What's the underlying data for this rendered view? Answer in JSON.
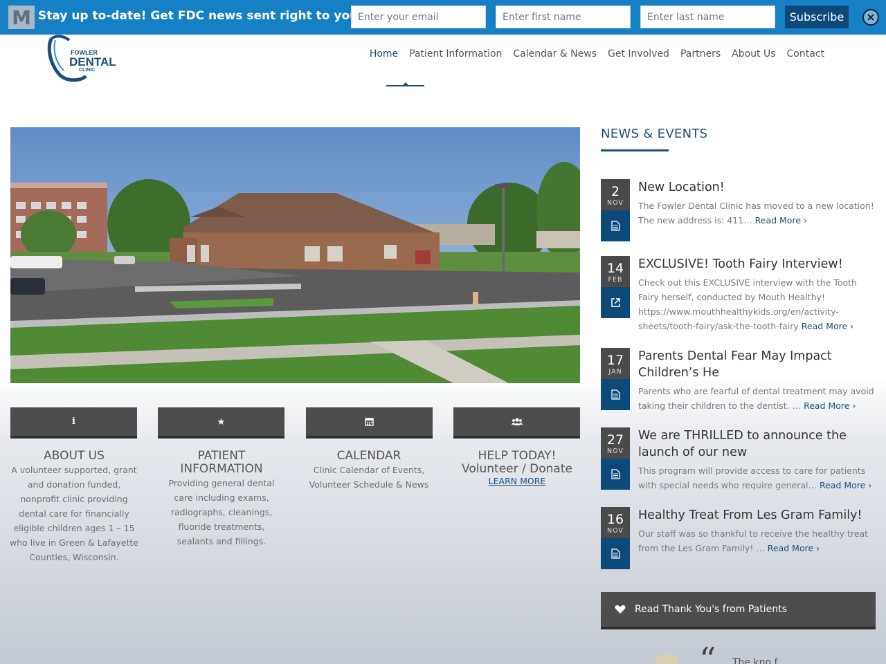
{
  "topbar": {
    "logo_letter": "M",
    "message": "Stay up to-date! Get FDC news sent right to your inbox",
    "email_placeholder": "Enter your email",
    "first_name_placeholder": "Enter first name",
    "last_name_placeholder": "Enter last name",
    "subscribe_label": "Subscribe",
    "close_icon": "close-icon"
  },
  "brand": {
    "line1": "FOWLER",
    "line2": "DENTAL",
    "line3": "CLINIC",
    "color": "#1d4f7b"
  },
  "nav": {
    "items": [
      {
        "label": "Home",
        "active": true
      },
      {
        "label": "Patient Information"
      },
      {
        "label": "Calendar & News"
      },
      {
        "label": "Get Involved"
      },
      {
        "label": "Partners"
      },
      {
        "label": "About Us"
      },
      {
        "label": "Contact"
      }
    ]
  },
  "features": [
    {
      "icon": "info-icon",
      "title": "ABOUT US",
      "desc": "A volunteer supported, grant and donation funded, nonprofit clinic providing dental care for financially eligible children ages 1 – 15 who live in Green & Lafayette Counties, Wisconsin."
    },
    {
      "icon": "star-icon",
      "title": "PATIENT INFORMATION",
      "desc": "Providing general dental care including exams, radiographs, cleanings, fluoride treatments, sealants and fillings."
    },
    {
      "icon": "calendar-icon",
      "title": "CALENDAR",
      "desc": "Clinic Calendar of Events, Volunteer Schedule & News"
    },
    {
      "icon": "users-icon",
      "title": "HELP TODAY!",
      "subtitle": "Volunteer / Donate",
      "link": "LEARN MORE"
    }
  ],
  "news": {
    "heading": "NEWS & EVENTS",
    "read_more": "Read More",
    "items": [
      {
        "day": "2",
        "month": "NOV",
        "type_icon": "document-icon",
        "title": "New Location!",
        "excerpt": "The Fowler Dental Clinic has moved to a new location!  The new address is: 411…"
      },
      {
        "day": "14",
        "month": "FEB",
        "type_icon": "external-link-icon",
        "title": "EXCLUSIVE! Tooth Fairy Interview!",
        "excerpt": "Check out this EXCLUSIVE interview with the Tooth Fairy herself, conducted by Mouth Healthy! https://www.mouthhealthykids.org/en/activity-sheets/tooth-fairy/ask-the-tooth-fairy"
      },
      {
        "day": "17",
        "month": "JAN",
        "type_icon": "document-icon",
        "title": "Parents Dental Fear May Impact Children’s He",
        "excerpt": "Parents who are fearful of dental treatment may avoid taking their children to the dentist. …"
      },
      {
        "day": "27",
        "month": "NOV",
        "type_icon": "document-icon",
        "title": "We are THRILLED to announce the launch of our new",
        "excerpt": "This program will provide access to care for patients with special needs who require general…"
      },
      {
        "day": "16",
        "month": "NOV",
        "type_icon": "document-icon",
        "title": "Healthy Treat From Les Gram Family!",
        "excerpt": "Our staff was so thankful to receive the healthy treat from the Les Gram Family! …"
      }
    ]
  },
  "thanks_button": "Read Thank You's from Patients",
  "quote_preview": "The kno f"
}
